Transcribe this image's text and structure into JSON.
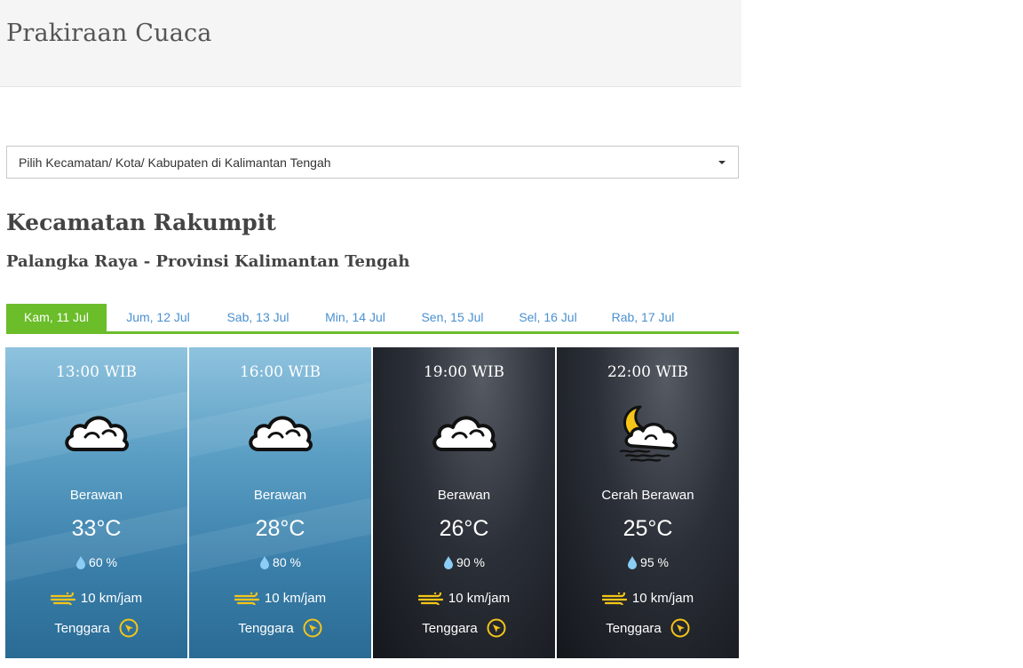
{
  "page": {
    "title": "Prakiraan Cuaca"
  },
  "selector": {
    "label": "Pilih Kecamatan/ Kota/ Kabupaten di Kalimantan Tengah"
  },
  "location": {
    "title": "Kecamatan Rakumpit",
    "subtitle": "Palangka Raya - Provinsi Kalimantan Tengah"
  },
  "tabs": [
    {
      "label": "Kam, 11 Jul",
      "active": true
    },
    {
      "label": "Jum, 12 Jul",
      "active": false
    },
    {
      "label": "Sab, 13 Jul",
      "active": false
    },
    {
      "label": "Min, 14 Jul",
      "active": false
    },
    {
      "label": "Sen, 15 Jul",
      "active": false
    },
    {
      "label": "Sel, 16 Jul",
      "active": false
    },
    {
      "label": "Rab, 17 Jul",
      "active": false
    }
  ],
  "forecast": [
    {
      "time": "13:00 WIB",
      "icon": "cloud-icon",
      "condition": "Berawan",
      "temp": "33°C",
      "humidity": "60 %",
      "wind_speed": "10 km/jam",
      "wind_dir": "Tenggara",
      "theme": "day"
    },
    {
      "time": "16:00 WIB",
      "icon": "cloud-icon",
      "condition": "Berawan",
      "temp": "28°C",
      "humidity": "80 %",
      "wind_speed": "10 km/jam",
      "wind_dir": "Tenggara",
      "theme": "day"
    },
    {
      "time": "19:00 WIB",
      "icon": "cloud-icon",
      "condition": "Berawan",
      "temp": "26°C",
      "humidity": "90 %",
      "wind_speed": "10 km/jam",
      "wind_dir": "Tenggara",
      "theme": "night"
    },
    {
      "time": "22:00 WIB",
      "icon": "moon-cloud-icon",
      "condition": "Cerah Berawan",
      "temp": "25°C",
      "humidity": "95 %",
      "wind_speed": "10 km/jam",
      "wind_dir": "Tenggara",
      "theme": "night"
    }
  ],
  "colors": {
    "accent_green": "#6bbd2a",
    "tab_link": "#4a90d0",
    "icon_yellow": "#f5c518",
    "drop_blue": "#8ccdf5"
  }
}
